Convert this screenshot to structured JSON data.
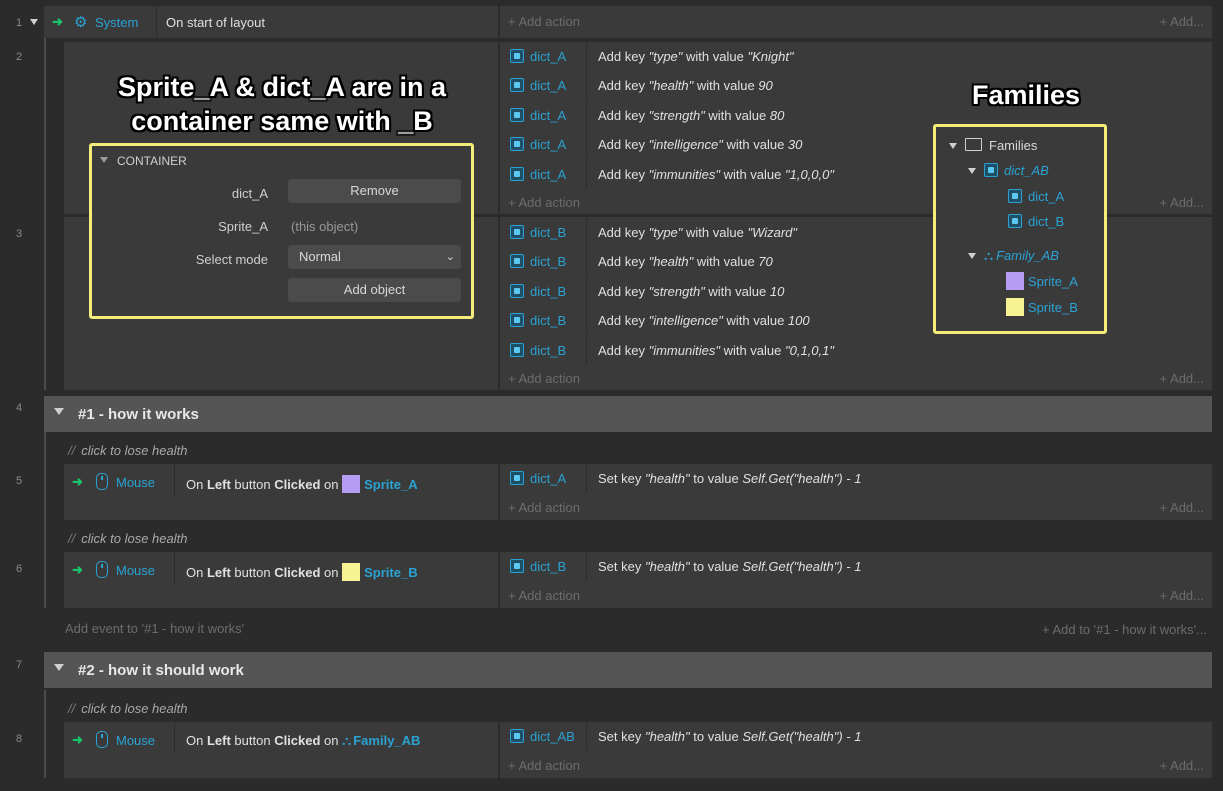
{
  "line_numbers": [
    "1",
    "2",
    "3",
    "4",
    "5",
    "6",
    "7",
    "8"
  ],
  "event1": {
    "object": "System",
    "condition": "On start of layout",
    "add_action": "Add action",
    "add_right": "Add..."
  },
  "event2": {
    "actions": [
      {
        "obj": "dict_A",
        "pre": "Add key ",
        "key": "\"type\"",
        "mid": " with value ",
        "val": "\"Knight\""
      },
      {
        "obj": "dict_A",
        "pre": "Add key ",
        "key": "\"health\"",
        "mid": " with value ",
        "val": "90"
      },
      {
        "obj": "dict_A",
        "pre": "Add key ",
        "key": "\"strength\"",
        "mid": " with value ",
        "val": "80"
      },
      {
        "obj": "dict_A",
        "pre": "Add key ",
        "key": "\"intelligence\"",
        "mid": " with value ",
        "val": "30"
      },
      {
        "obj": "dict_A",
        "pre": "Add key ",
        "key": "\"immunities\"",
        "mid": " with value ",
        "val": "\"1,0,0,0\""
      }
    ],
    "add_action": "Add action",
    "add_right": "Add..."
  },
  "event3": {
    "actions": [
      {
        "obj": "dict_B",
        "pre": "Add key ",
        "key": "\"type\"",
        "mid": " with value ",
        "val": "\"Wizard\""
      },
      {
        "obj": "dict_B",
        "pre": "Add key ",
        "key": "\"health\"",
        "mid": " with value ",
        "val": "70"
      },
      {
        "obj": "dict_B",
        "pre": "Add key ",
        "key": "\"strength\"",
        "mid": " with value ",
        "val": "10"
      },
      {
        "obj": "dict_B",
        "pre": "Add key ",
        "key": "\"intelligence\"",
        "mid": " with value ",
        "val": "100"
      },
      {
        "obj": "dict_B",
        "pre": "Add key ",
        "key": "\"immunities\"",
        "mid": " with value ",
        "val": "\"0,1,0,1\""
      }
    ],
    "add_action": "Add action",
    "add_right": "Add..."
  },
  "callout_container": "Sprite_A & dict_A are in a container same with _B",
  "callout_families": "Families",
  "container_panel": {
    "header": "CONTAINER",
    "rows": [
      {
        "label": "dict_A",
        "value": "Remove"
      },
      {
        "label": "Sprite_A",
        "value": "(this object)"
      },
      {
        "label": "Select mode",
        "value": "Normal"
      }
    ],
    "add_object": "Add object"
  },
  "families_panel": {
    "root": "Families",
    "family1": "dict_AB",
    "family1_members": [
      "dict_A",
      "dict_B"
    ],
    "family2": "Family_AB",
    "family2_members": [
      "Sprite_A",
      "Sprite_B"
    ]
  },
  "group1": {
    "title": "#1 - how it works",
    "comment": "click to lose health",
    "event5": {
      "object": "Mouse",
      "cond_pre": "On ",
      "cond_b1": "Left",
      "cond_mid": " button ",
      "cond_b2": "Clicked",
      "cond_on": " on ",
      "target": "Sprite_A",
      "action_obj": "dict_A",
      "action_pre": "Set key ",
      "action_key": "\"health\"",
      "action_mid": " to value ",
      "action_val": "Self.Get(\"health\") - 1"
    },
    "event6": {
      "object": "Mouse",
      "cond_pre": "On ",
      "cond_b1": "Left",
      "cond_mid": " button ",
      "cond_b2": "Clicked",
      "cond_on": " on ",
      "target": "Sprite_B",
      "action_obj": "dict_B",
      "action_pre": "Set key ",
      "action_key": "\"health\"",
      "action_mid": " to value ",
      "action_val": "Self.Get(\"health\") - 1"
    },
    "add_event": "Add event to '#1 - how it works'",
    "add_to": "Add to '#1 - how it works'..."
  },
  "group2": {
    "title": "#2 - how it should work",
    "comment": "click to lose health",
    "event8": {
      "object": "Mouse",
      "cond_pre": "On ",
      "cond_b1": "Left",
      "cond_mid": " button ",
      "cond_b2": "Clicked",
      "cond_on": " on ",
      "target": "Family_AB",
      "action_obj": "dict_AB",
      "action_pre": "Set key ",
      "action_key": "\"health\"",
      "action_mid": " to value ",
      "action_val": "Self.Get(\"health\") - 1"
    }
  },
  "add_action": "Add action",
  "add_right": "Add...",
  "colors": {
    "sprite_a": "#b69cf5",
    "sprite_b": "#f7f392",
    "accent": "#2aa3d4",
    "highlight": "#f4ec7a"
  },
  "icons": [
    "gear-icon",
    "arrow-icon",
    "dict-icon",
    "mouse-icon",
    "folder-icon",
    "family-icon",
    "plus-icon",
    "triangle-icon"
  ]
}
